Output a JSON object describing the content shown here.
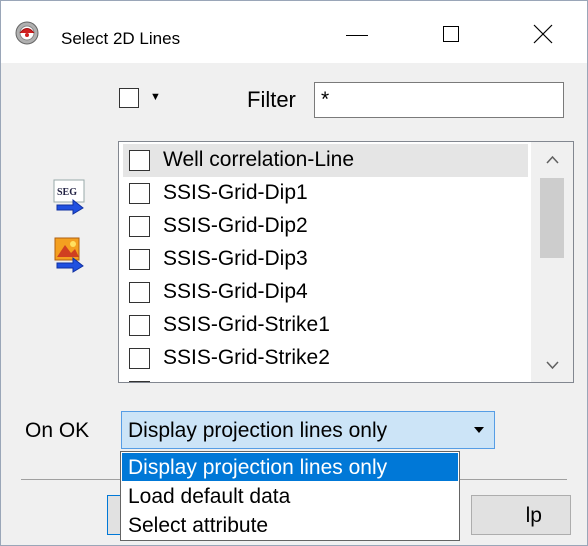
{
  "window": {
    "title": "Select 2D Lines",
    "icon": "app-icon"
  },
  "filter": {
    "label": "Filter",
    "value": "*"
  },
  "list": {
    "items": [
      {
        "label": "Well correlation-Line",
        "checked": false,
        "selected": true
      },
      {
        "label": "SSIS-Grid-Dip1",
        "checked": false
      },
      {
        "label": "SSIS-Grid-Dip2",
        "checked": false
      },
      {
        "label": "SSIS-Grid-Dip3",
        "checked": false
      },
      {
        "label": "SSIS-Grid-Dip4",
        "checked": false
      },
      {
        "label": "SSIS-Grid-Strike1",
        "checked": false
      },
      {
        "label": "SSIS-Grid-Strike2",
        "checked": false
      }
    ]
  },
  "side_icons": [
    "seg-import-icon",
    "image-import-icon"
  ],
  "on_ok": {
    "label": "On OK",
    "selected": "Display projection lines only",
    "options": [
      "Display projection lines only",
      "Load default data",
      "Select attribute"
    ]
  },
  "buttons": {
    "help_partial": "lp"
  },
  "colors": {
    "accent": "#0078d7",
    "combo_bg": "#cce4f7",
    "selected_row": "#e5e5e5"
  }
}
